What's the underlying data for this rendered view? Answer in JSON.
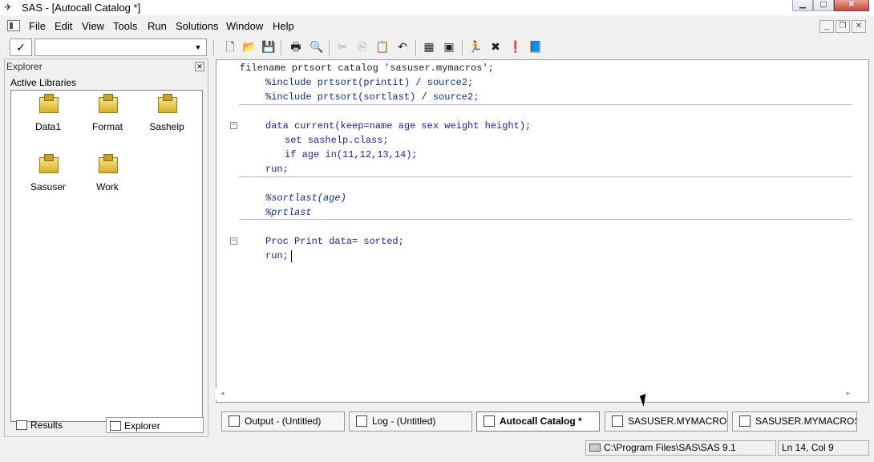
{
  "window": {
    "title": "SAS - [Autocall Catalog *]"
  },
  "menu": [
    "File",
    "Edit",
    "View",
    "Tools",
    "Run",
    "Solutions",
    "Window",
    "Help"
  ],
  "toolbar": {
    "command_check": "✓",
    "command_value": ""
  },
  "explorer": {
    "title": "Explorer",
    "section": "Active Libraries",
    "libraries": [
      "Data1",
      "Format",
      "Sashelp",
      "Sasuser",
      "Work"
    ],
    "tabs": [
      "Results",
      "Explorer"
    ],
    "active_tab": "Explorer"
  },
  "editor": {
    "lines": [
      "filename prtsort catalog 'sasuser.mymacros';",
      "%include prtsort(printit) / source2;",
      "%include prtsort(sortlast) / source2;",
      "data current(keep=name age sex weight height);",
      "set sashelp.class;",
      "if age in(11,12,13,14);",
      "run;",
      "%sortlast(age)",
      "%prtlast",
      "Proc Print data= sorted;",
      "run;"
    ]
  },
  "window_tabs": [
    "Output - (Untitled)",
    "Log - (Untitled)",
    "Autocall Catalog *",
    "SASUSER.MYMACROS....",
    "SASUSER.MYMACROS...."
  ],
  "active_window_tab": "Autocall Catalog *",
  "status": {
    "path": "C:\\Program Files\\SAS\\SAS 9.1",
    "position": "Ln 14, Col 9"
  }
}
